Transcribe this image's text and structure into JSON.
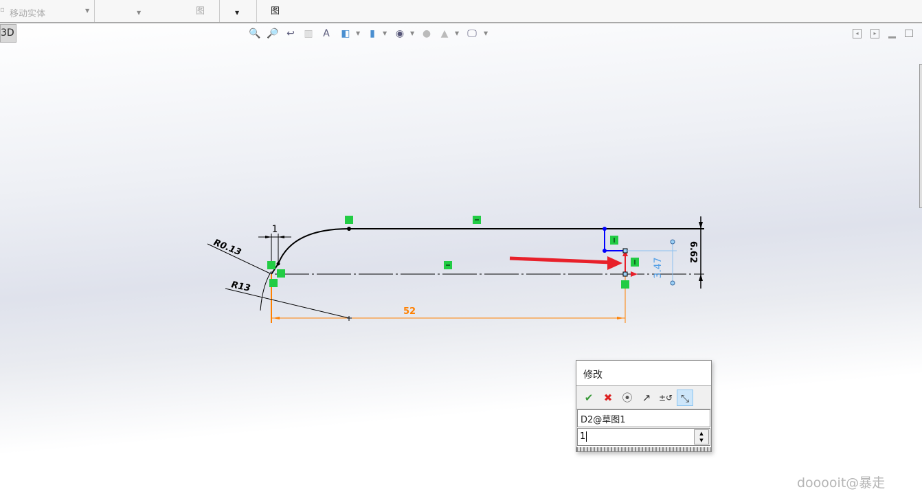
{
  "toolbar": {
    "move_entity": "移动实体",
    "view_label_1": "图",
    "view_label_2": "图"
  },
  "view_tab": "3D",
  "heads_up_icons": [
    "zoom-to-fit-icon",
    "zoom-to-area-icon",
    "previous-view-icon",
    "section-view-icon",
    "dynamic-annotation-icon",
    "view-orientation-icon",
    "display-style-icon",
    "hide-show-icon",
    "edit-appearance-icon",
    "apply-scene-icon",
    "view-settings-icon"
  ],
  "sketch": {
    "dim_r013": "R0.13",
    "dim_r13": "R13",
    "dim_1": "1",
    "dim_52": "52",
    "dim_347": "3.47",
    "dim_662": "6.62",
    "colors": {
      "line": "#000000",
      "construction": "#ff8000",
      "selected": "#0000ff",
      "driven": "#55a0e6",
      "arrow": "#e8202a",
      "relation": "#22cc44"
    }
  },
  "dialog": {
    "title": "修改",
    "dim_name": "D2@草图1",
    "value": "1",
    "tools": [
      "ok-check-icon",
      "cancel-x-icon",
      "rebuild-traffic-light-icon",
      "reverse-dimension-icon",
      "increment-icon",
      "mark-for-drawing-icon"
    ]
  },
  "watermark": "dooooit@暴走"
}
